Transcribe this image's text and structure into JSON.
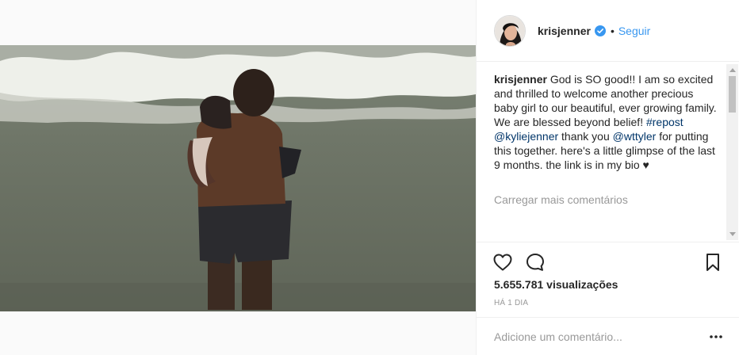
{
  "header": {
    "username": "krisjenner",
    "dot": "•",
    "follow_label": "Seguir"
  },
  "caption": {
    "author": "krisjenner",
    "text_1": " God is SO good!! I am so excited and thrilled to welcome another precious baby girl to our beautiful, ever growing family. We are blessed beyond belief! ",
    "hashtag": "#repost",
    "space_1": " ",
    "mention_1": "@kyliejenner",
    "text_2": " thank you ",
    "mention_2": "@wttyler",
    "text_3": " for putting this together. here's a little glimpse of the last 9 months. the link is in my bio ♥"
  },
  "load_more_label": "Carregar mais comentários",
  "views_text": "5.655.781 visualizações",
  "timestamp": "HÁ 1 DIA",
  "comment_box": {
    "placeholder": "Adicione um comentário..."
  },
  "colors": {
    "link": "#3897f0",
    "verified": "#3897f0",
    "mention": "#003569"
  },
  "icons": {
    "like": "heart-icon",
    "comment": "speech-bubble-icon",
    "save": "bookmark-icon",
    "more": "more-options-icon",
    "verified": "verified-badge-icon"
  }
}
